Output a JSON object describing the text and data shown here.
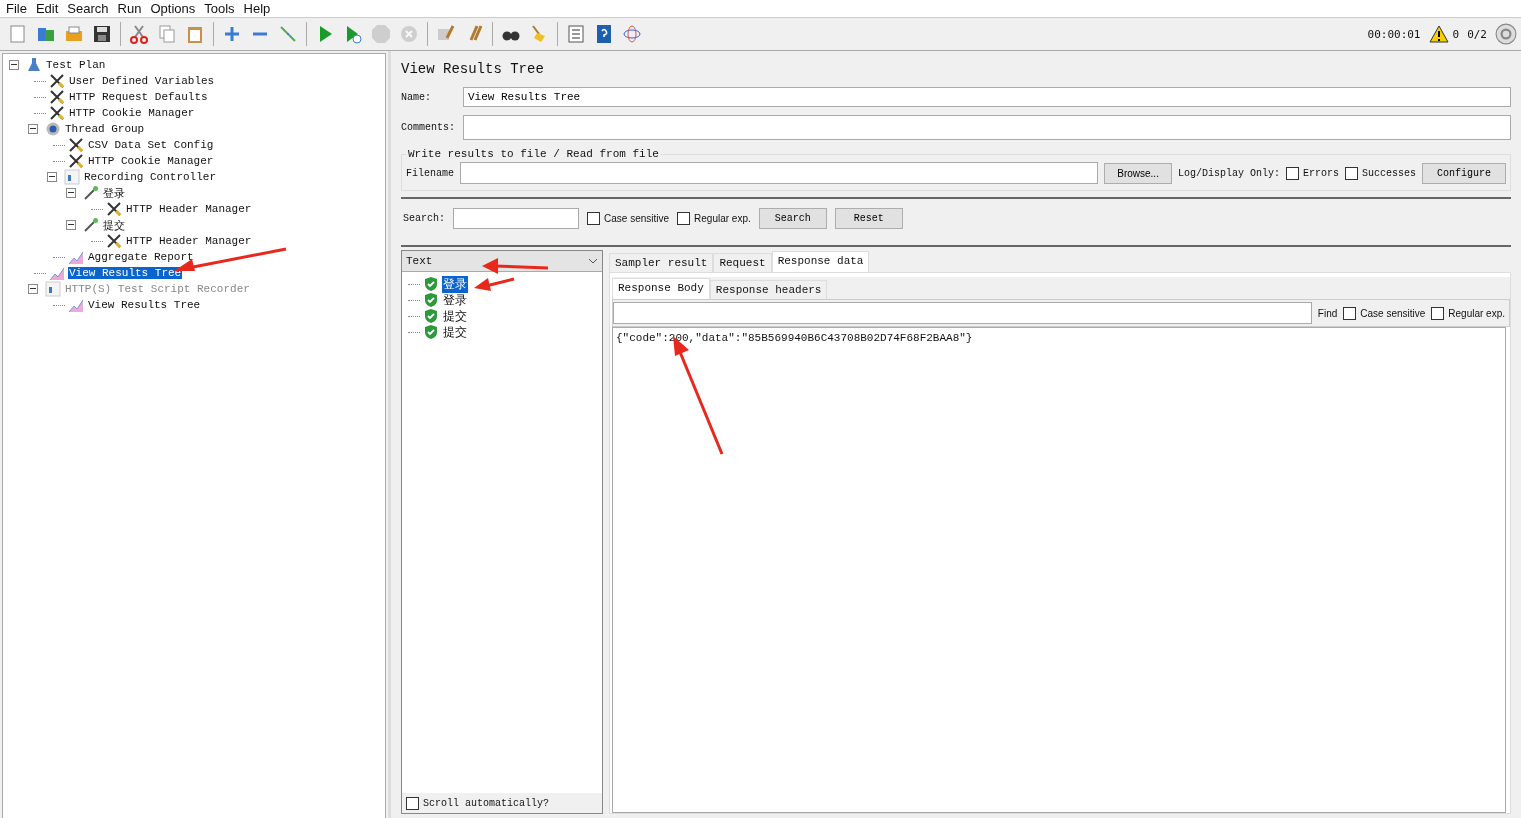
{
  "menu": [
    "File",
    "Edit",
    "Search",
    "Run",
    "Options",
    "Tools",
    "Help"
  ],
  "toolbar": [
    {
      "kind": "new",
      "disabled": false
    },
    {
      "kind": "templates",
      "disabled": false
    },
    {
      "kind": "open",
      "disabled": false
    },
    {
      "kind": "save",
      "disabled": false
    },
    {
      "kind": "sep"
    },
    {
      "kind": "cut",
      "disabled": false
    },
    {
      "kind": "copy",
      "disabled": false
    },
    {
      "kind": "paste",
      "disabled": false
    },
    {
      "kind": "sep"
    },
    {
      "kind": "expand",
      "disabled": false
    },
    {
      "kind": "collapse",
      "disabled": false
    },
    {
      "kind": "toggle",
      "disabled": false
    },
    {
      "kind": "sep"
    },
    {
      "kind": "start",
      "disabled": false
    },
    {
      "kind": "start-no-pause",
      "disabled": false
    },
    {
      "kind": "stop",
      "disabled": true
    },
    {
      "kind": "shutdown",
      "disabled": true
    },
    {
      "kind": "sep"
    },
    {
      "kind": "clear",
      "disabled": false
    },
    {
      "kind": "clear-all",
      "disabled": false
    },
    {
      "kind": "sep"
    },
    {
      "kind": "search",
      "disabled": false
    },
    {
      "kind": "reset-search",
      "disabled": false
    },
    {
      "kind": "sep"
    },
    {
      "kind": "function-helper",
      "disabled": false
    },
    {
      "kind": "help",
      "disabled": false
    },
    {
      "kind": "remote",
      "disabled": false
    }
  ],
  "status": {
    "elapsed": "00:00:01",
    "warnings": "0",
    "threads": "0/2"
  },
  "test_tree": [
    {
      "label": "Test Plan",
      "kind": "plan",
      "expanded": true,
      "selected": false,
      "disabled": false,
      "children": [
        {
          "label": "User Defined Variables",
          "kind": "config",
          "selected": false,
          "disabled": false
        },
        {
          "label": "HTTP Request Defaults",
          "kind": "config",
          "selected": false,
          "disabled": false
        },
        {
          "label": "HTTP Cookie Manager",
          "kind": "config",
          "selected": false,
          "disabled": false
        },
        {
          "label": "Thread Group",
          "kind": "thread",
          "expanded": true,
          "selected": false,
          "disabled": false,
          "children": [
            {
              "label": "CSV Data Set Config",
              "kind": "config",
              "selected": false,
              "disabled": false
            },
            {
              "label": "HTTP Cookie Manager",
              "kind": "config",
              "selected": false,
              "disabled": false
            },
            {
              "label": "Recording Controller",
              "kind": "controller",
              "expanded": true,
              "selected": false,
              "disabled": false,
              "children": [
                {
                  "label": "登录",
                  "kind": "sampler",
                  "expanded": true,
                  "selected": false,
                  "disabled": false,
                  "children": [
                    {
                      "label": "HTTP Header Manager",
                      "kind": "config",
                      "selected": false,
                      "disabled": false
                    }
                  ]
                },
                {
                  "label": "提交",
                  "kind": "sampler",
                  "expanded": true,
                  "selected": false,
                  "disabled": false,
                  "children": [
                    {
                      "label": "HTTP Header Manager",
                      "kind": "config",
                      "selected": false,
                      "disabled": false
                    }
                  ]
                }
              ]
            },
            {
              "label": "Aggregate Report",
              "kind": "listener",
              "selected": false,
              "disabled": false
            }
          ]
        },
        {
          "label": "View Results Tree",
          "kind": "listener",
          "selected": true,
          "disabled": false
        },
        {
          "label": "HTTP(S) Test Script Recorder",
          "kind": "controller",
          "expanded": true,
          "selected": false,
          "disabled": true,
          "children": [
            {
              "label": "View Results Tree",
              "kind": "listener",
              "selected": false,
              "disabled": false
            }
          ]
        }
      ]
    }
  ],
  "panel": {
    "title": "View Results Tree",
    "name_label": "Name:",
    "name_value": "View Results Tree",
    "comments_label": "Comments:",
    "file_group": {
      "legend": "Write results to file / Read from file",
      "filename_label": "Filename",
      "browse": "Browse...",
      "log_label": "Log/Display Only:",
      "errors": {
        "label": "Errors",
        "checked": false
      },
      "successes": {
        "label": "Successes",
        "checked": false
      },
      "configure": "Configure"
    },
    "search": {
      "label": "Search:",
      "case_sensitive": {
        "label": "Case sensitive",
        "checked": false
      },
      "regex": {
        "label": "Regular exp.",
        "checked": false
      },
      "search_button": "Search",
      "reset_button": "Reset"
    }
  },
  "results": {
    "renderer": "Text",
    "items": [
      {
        "label": "登录",
        "success": true,
        "selected": true
      },
      {
        "label": "登录",
        "success": true,
        "selected": false
      },
      {
        "label": "提交",
        "success": true,
        "selected": false
      },
      {
        "label": "提交",
        "success": true,
        "selected": false
      }
    ],
    "scroll_auto": {
      "label": "Scroll automatically?",
      "checked": false
    }
  },
  "tabs": [
    {
      "label": "Sampler result",
      "selected": false
    },
    {
      "label": "Request",
      "selected": false
    },
    {
      "label": "Response data",
      "selected": true
    }
  ],
  "subtabs": [
    {
      "label": "Response Body",
      "selected": true
    },
    {
      "label": "Response headers",
      "selected": false
    }
  ],
  "find": {
    "label": "Find",
    "case_sensitive": {
      "label": "Case sensitive",
      "checked": false
    },
    "regex": {
      "label": "Regular exp.",
      "checked": false
    }
  },
  "response_body": "{\"code\":200,\"data\":\"85B569940B6C43708B02D74F68F2BAA8\"}"
}
